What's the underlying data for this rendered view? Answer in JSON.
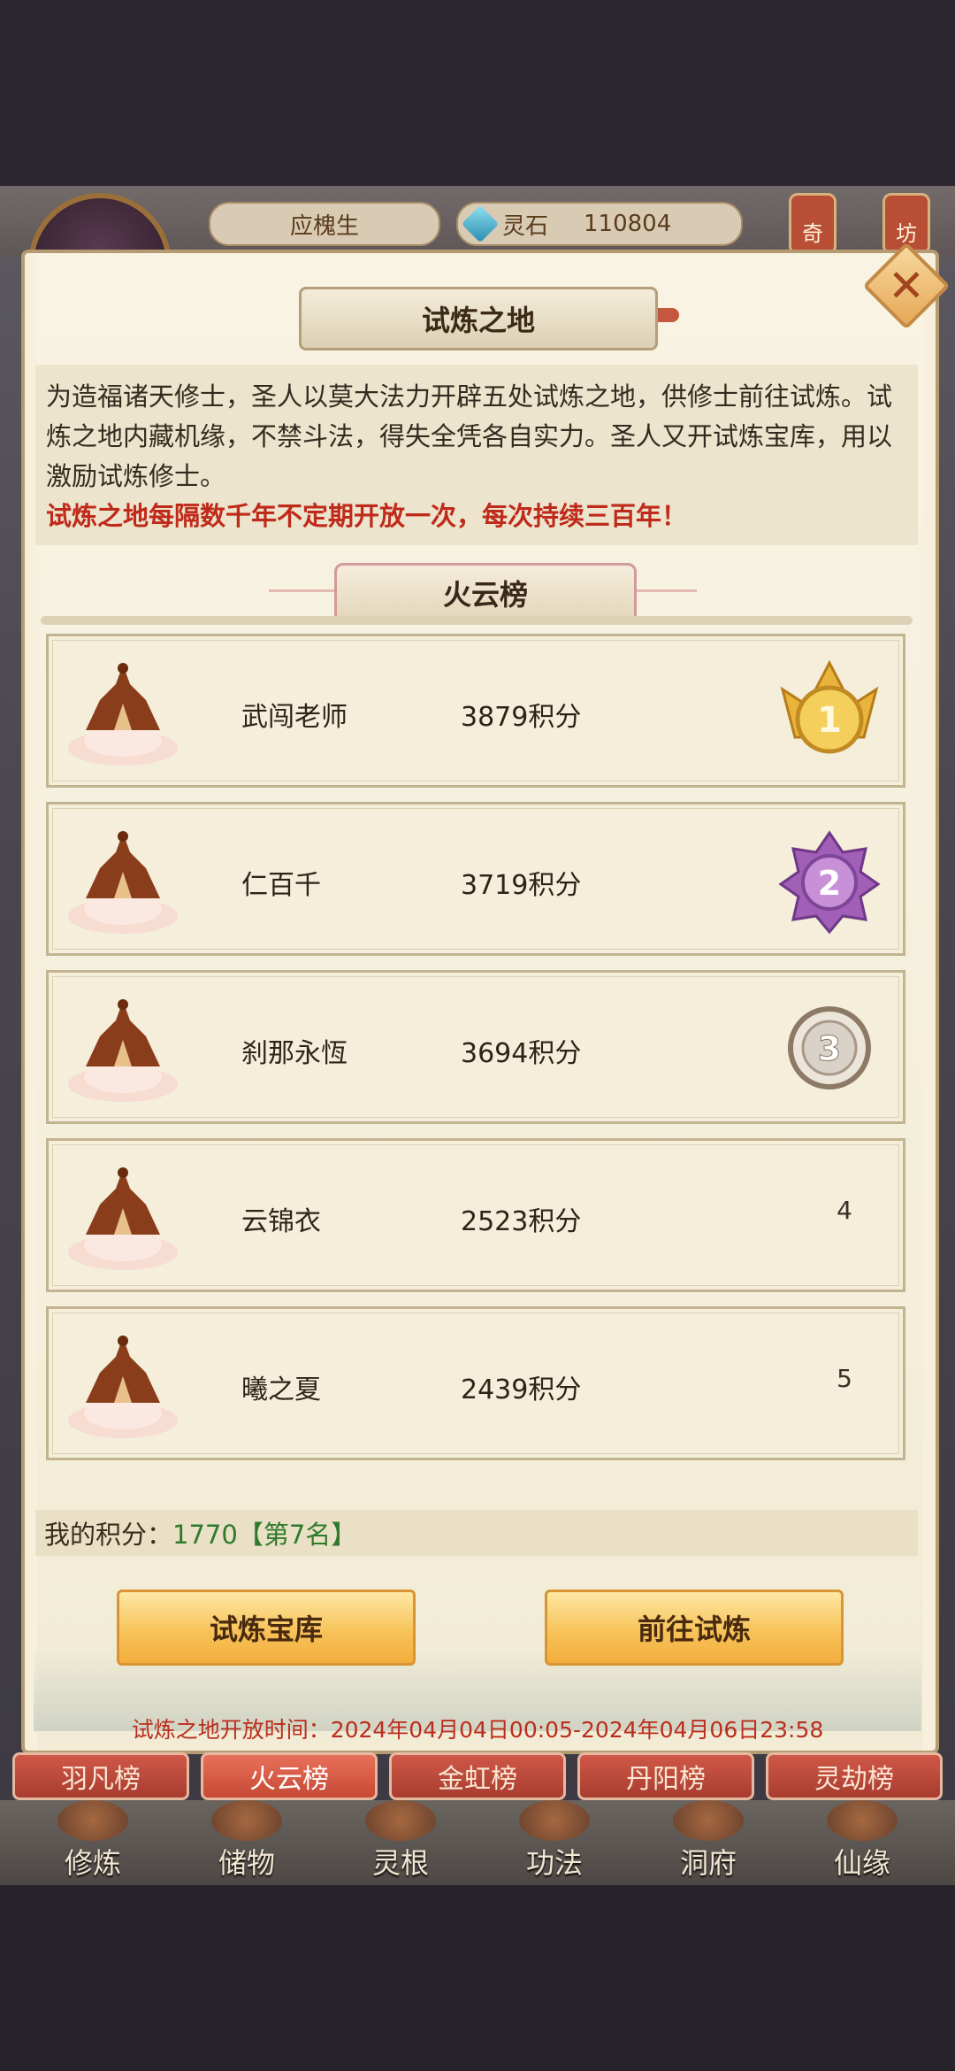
{
  "header": {
    "player_name": "应槐生",
    "currency_label": "灵石",
    "currency_value": "110804",
    "side_buttons": [
      "奇",
      "坊"
    ]
  },
  "modal": {
    "title": "试炼之地",
    "description": "为造福诸天修士，圣人以莫大法力开辟五处试炼之地，供修士前往试炼。试炼之地内藏机缘，不禁斗法，得失全凭各自实力。圣人又开试炼宝库，用以激励试炼修士。",
    "notice": "试炼之地每隔数千年不定期开放一次，每次持续三百年！",
    "board_title": "火云榜",
    "rankings": [
      {
        "rank": "1",
        "name": "武闯老师",
        "score": "3879积分",
        "medal": "gold"
      },
      {
        "rank": "2",
        "name": "仁百千",
        "score": "3719积分",
        "medal": "purple"
      },
      {
        "rank": "3",
        "name": "刹那永恆",
        "score": "3694积分",
        "medal": "silver"
      },
      {
        "rank": "4",
        "name": "云锦衣",
        "score": "2523积分",
        "medal": ""
      },
      {
        "rank": "5",
        "name": "曦之夏",
        "score": "2439积分",
        "medal": ""
      }
    ],
    "my_score_label": "我的积分：",
    "my_score_value": "1770【第7名】",
    "buttons": {
      "treasury": "试炼宝库",
      "go_trial": "前往试炼"
    },
    "open_time": "试炼之地开放时间：2024年04月04日00:05-2024年04月06日23:58"
  },
  "tabs": [
    "羽凡榜",
    "火云榜",
    "金虹榜",
    "丹阳榜",
    "灵劫榜"
  ],
  "active_tab": "火云榜",
  "bottom_nav": [
    "修炼",
    "储物",
    "灵根",
    "功法",
    "洞府",
    "仙缘"
  ],
  "colors": {
    "notice_red": "#c02a1b",
    "score_green": "#2f7a2a",
    "gold_button": "#f7c35a"
  }
}
